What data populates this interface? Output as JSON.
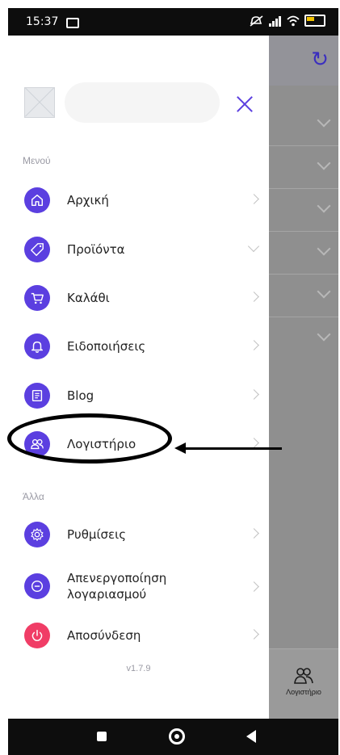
{
  "status_bar": {
    "time": "15:37"
  },
  "background_app": {
    "bottom_tab_label": "Λογιστήριο"
  },
  "drawer": {
    "section_menu": "Μενού",
    "section_other": "Άλλα",
    "menu_items": [
      {
        "label": "Αρχική",
        "icon": "home-icon"
      },
      {
        "label": "Προϊόντα",
        "icon": "tag-icon"
      },
      {
        "label": "Καλάθι",
        "icon": "cart-icon"
      },
      {
        "label": "Ειδοποιήσεις",
        "icon": "bell-icon"
      },
      {
        "label": "Blog",
        "icon": "document-icon"
      },
      {
        "label": "Λογιστήριο",
        "icon": "people-icon"
      }
    ],
    "other_items": [
      {
        "label": "Ρυθμίσεις",
        "icon": "gear-icon"
      },
      {
        "label": "Απενεργοποίηση λογαριασμού",
        "label_line1": "Απενεργοποίηση",
        "label_line2": "λογαριασμού",
        "icon": "minus-circle-icon"
      },
      {
        "label": "Αποσύνδεση",
        "icon": "power-icon"
      }
    ],
    "version": "v1.7.9"
  },
  "colors": {
    "accent": "#5b3fe0",
    "logout": "#f03d66",
    "annotation": "#000000"
  }
}
